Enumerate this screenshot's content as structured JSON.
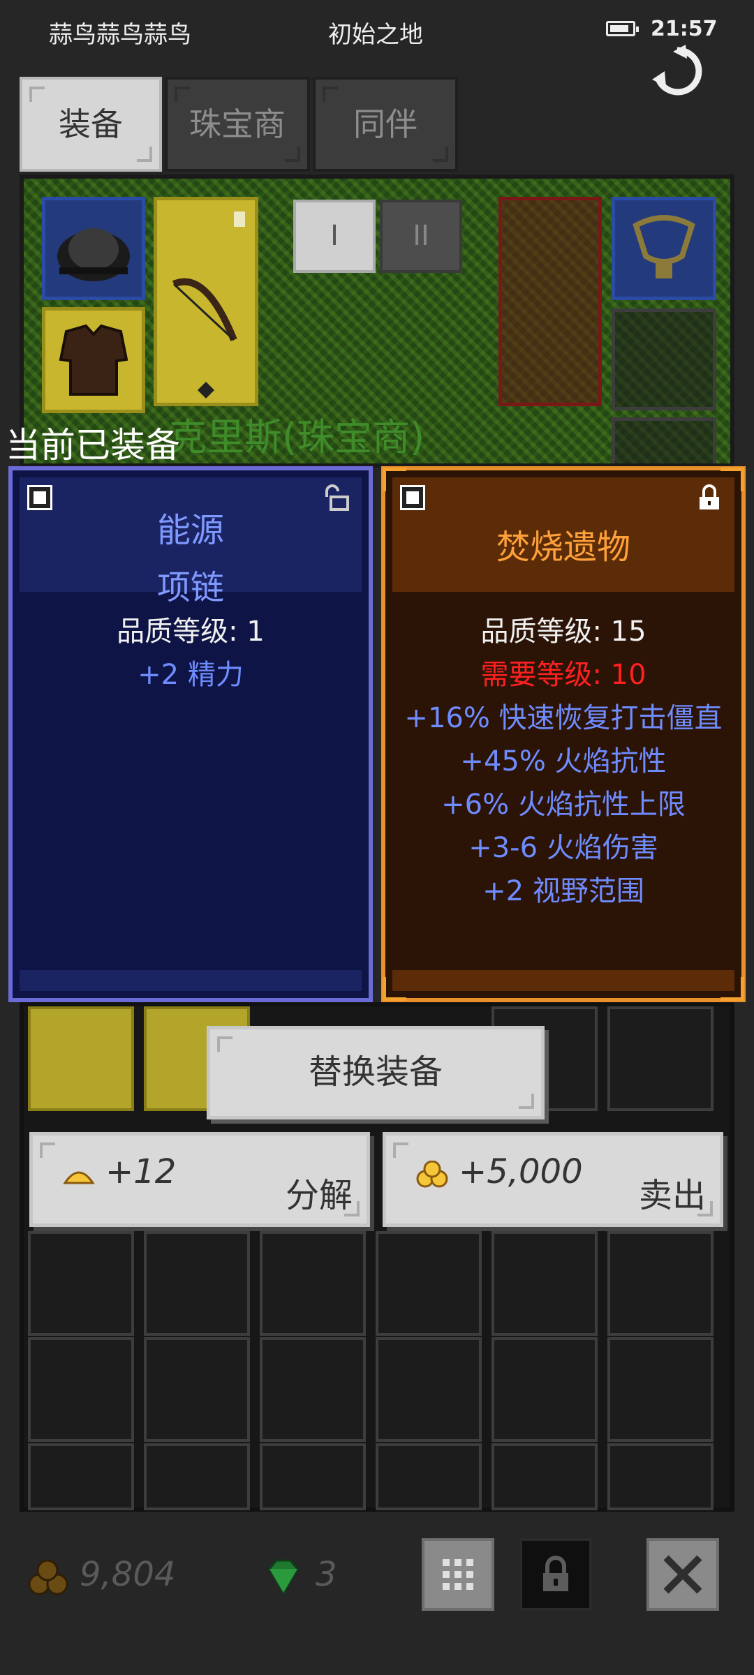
{
  "status_bar": {
    "left_text": "蒜鸟蒜鸟蒜鸟",
    "center_text": "初始之地",
    "time": "21:57"
  },
  "tabs": [
    {
      "label": "装备",
      "active": true
    },
    {
      "label": "珠宝商",
      "active": false
    },
    {
      "label": "同伴",
      "active": false
    }
  ],
  "scene": {
    "pager": [
      "I",
      "II"
    ],
    "character_name": "克里斯(珠宝商)",
    "equipped_label": "当前已装备"
  },
  "equipped_item": {
    "name_line1": "能源",
    "name_line2": "项链",
    "quality": "品质等级: 1",
    "stats": [
      "+2 精力"
    ],
    "color": "#7f99ff"
  },
  "new_item": {
    "name": "焚烧遗物",
    "quality": "品质等级: 15",
    "requirement": "需要等级: 10",
    "stats": [
      "+16% 快速恢复打击僵直",
      "+45% 火焰抗性",
      "+6% 火焰抗性上限",
      "+3-6 火焰伤害",
      "+2 视野范围"
    ],
    "color": "#ffa13a"
  },
  "actions": {
    "replace_label": "替换装备",
    "salvage_amount": "+12",
    "salvage_label": "分解",
    "sell_amount": "+5,000",
    "sell_label": "卖出"
  },
  "currency": {
    "gold": "9,804",
    "gems": "3"
  },
  "icons": {
    "refresh": "refresh-icon",
    "grid": "grid-icon",
    "lock": "lock-icon",
    "close": "close-icon",
    "gold": "gold-coins-icon",
    "gem": "emerald-gem-icon"
  }
}
